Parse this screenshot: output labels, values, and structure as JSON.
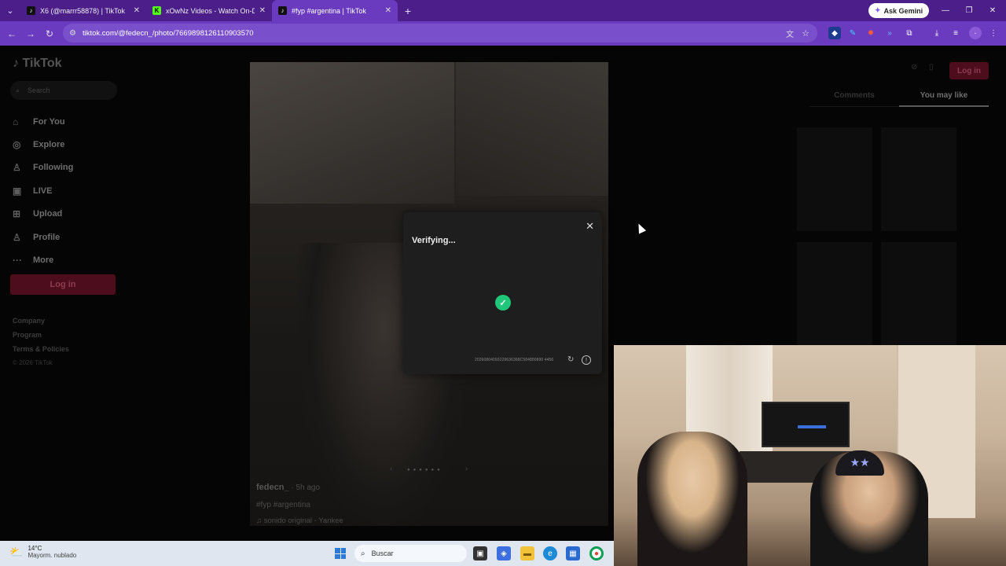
{
  "browser": {
    "tabs": [
      {
        "title": "X6 (@marrr58878) | TikTok",
        "favicon": "tiktok-icon",
        "active": false
      },
      {
        "title": "xOwNz Videos - Watch On-Der",
        "favicon": "kick-icon",
        "active": false
      },
      {
        "title": "#fyp #argentina | TikTok",
        "favicon": "tiktok-icon",
        "active": true
      }
    ],
    "ask_gemini": "Ask Gemini",
    "url": "tiktok.com/@fedecn_/photo/7669898126110903570",
    "colors": {
      "tabbar": "#4b1e8a",
      "toolbar": "#6b3bbf"
    }
  },
  "tiktok": {
    "logo": "TikTok",
    "search_placeholder": "Search",
    "nav": [
      {
        "label": "For You",
        "icon": "home-icon"
      },
      {
        "label": "Explore",
        "icon": "compass-icon"
      },
      {
        "label": "Following",
        "icon": "user-icon"
      },
      {
        "label": "LIVE",
        "icon": "live-icon"
      },
      {
        "label": "Upload",
        "icon": "plus-square-icon"
      },
      {
        "label": "Profile",
        "icon": "profile-icon"
      },
      {
        "label": "More",
        "icon": "more-dots-icon"
      }
    ],
    "login_button": "Log in",
    "footer": [
      "Company",
      "Program",
      "Terms & Policies"
    ],
    "copyright": "© 2026 TikTok",
    "post": {
      "username": "fedecn_",
      "time": "5h ago",
      "hashtags": "#fyp #argentina",
      "sound": "sonido original - Yankee"
    },
    "right_tabs": {
      "comments": "Comments",
      "you_may_like": "You may like"
    },
    "top_login": "Log in"
  },
  "modal": {
    "title": "Verifying...",
    "token": "20260804093229636368C584880890 4456",
    "status_color": "#20c77a"
  },
  "taskbar": {
    "temperature": "14°C",
    "weather_desc": "Mayorm. nublado",
    "search_label": "Buscar"
  }
}
